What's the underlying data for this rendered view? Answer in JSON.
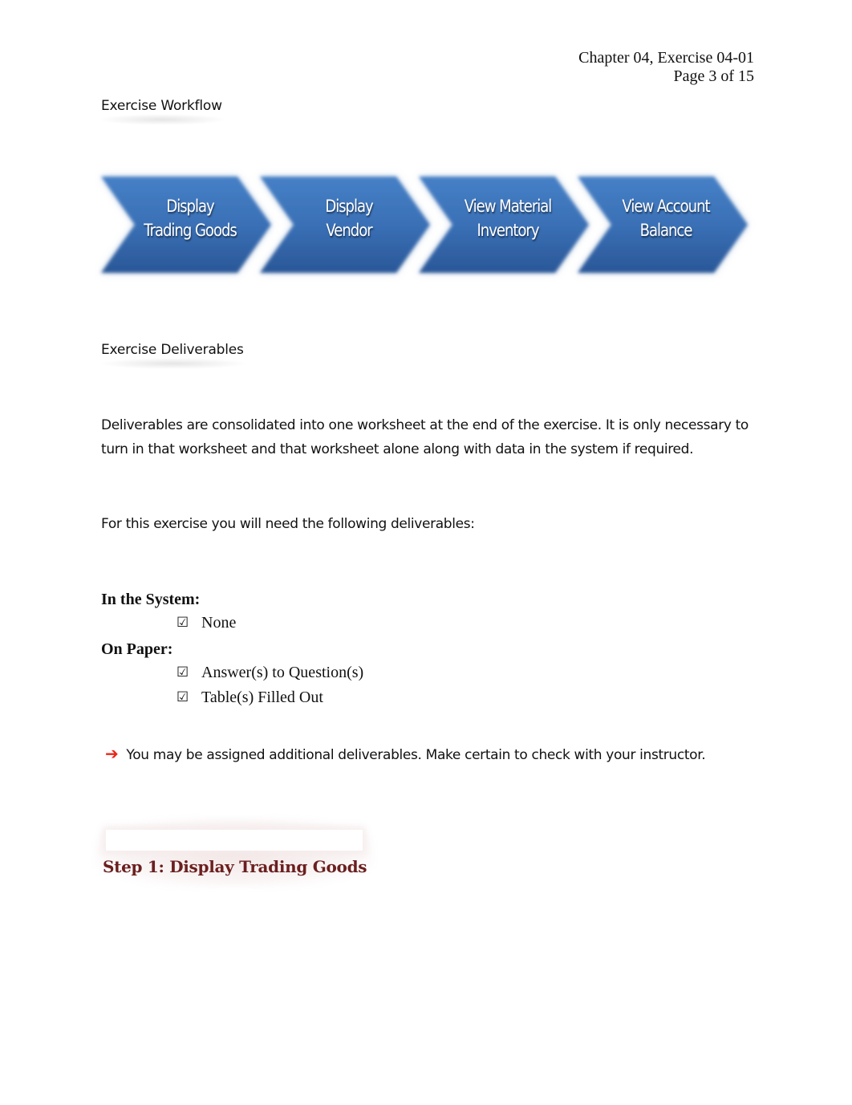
{
  "header": {
    "chapter_line": "Chapter 04, Exercise 04-01",
    "page_line": "Page 3 of 15"
  },
  "workflow": {
    "label": "Exercise Workflow",
    "steps": [
      {
        "line1": "Display",
        "line2": "Trading Goods"
      },
      {
        "line1": "Display",
        "line2": "Vendor"
      },
      {
        "line1": "View Material",
        "line2": "Inventory"
      },
      {
        "line1": "View Account",
        "line2": "Balance"
      }
    ],
    "colors": {
      "chevron_top": "#3f78c0",
      "chevron_bottom": "#2b5a9e"
    }
  },
  "deliverables": {
    "label": "Exercise Deliverables",
    "paragraph1": "Deliverables are consolidated into one worksheet at the end of the exercise. It is only necessary to turn in that worksheet and that worksheet alone along with data in the system if required.",
    "paragraph2": "For this exercise you will need the following deliverables:",
    "in_system": {
      "heading": "In the System:",
      "items": [
        {
          "icon": "checkbox-checked",
          "label": "None"
        }
      ]
    },
    "on_paper": {
      "heading": "On Paper:",
      "items": [
        {
          "icon": "checkbox-checked",
          "label": "Answer(s) to Question(s)"
        },
        {
          "icon": "checkbox-checked",
          "label": "Table(s) Filled Out"
        }
      ]
    },
    "note": {
      "icon": "red-arrow-right",
      "text": "You may be assigned additional deliverables. Make certain to check with your instructor."
    }
  },
  "step": {
    "title": "Step 1: Display Trading Goods",
    "color": "#6b1f1f"
  },
  "glyphs": {
    "check": "☑",
    "arrow": "➔"
  }
}
